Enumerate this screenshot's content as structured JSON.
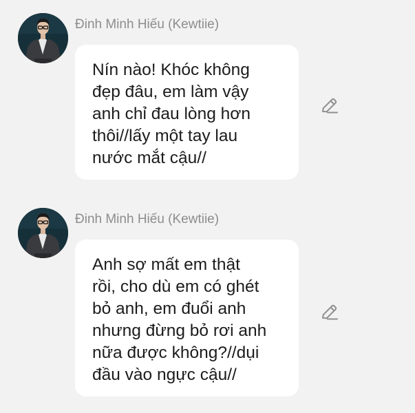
{
  "messages": [
    {
      "sender": "Đinh Minh Hiếu (Kewtiie)",
      "avatar_icon": "user-avatar-icon",
      "text": "Nín nào! Khóc không\nđẹp đâu, em làm vậy\nanh chỉ đau lòng hơn\nthôi//lấy một tay lau\nnước mắt cậu//",
      "action_icon": "pencil-edit-icon"
    },
    {
      "sender": "Đinh Minh Hiếu (Kewtiie)",
      "avatar_icon": "user-avatar-icon",
      "text": "Anh sợ mất em thật\nrồi, cho dù em có ghét\nbỏ anh, em đuổi anh\nnhưng đừng bỏ rơi anh\nnữa được không?//dụi\nđầu vào ngực cậu//",
      "action_icon": "pencil-edit-icon"
    }
  ],
  "colors": {
    "background": "#f2f2f2",
    "bubble": "#ffffff",
    "sender_text": "#8d8d8d",
    "message_text": "#1c1c1c",
    "icon": "#8f8f8f"
  }
}
